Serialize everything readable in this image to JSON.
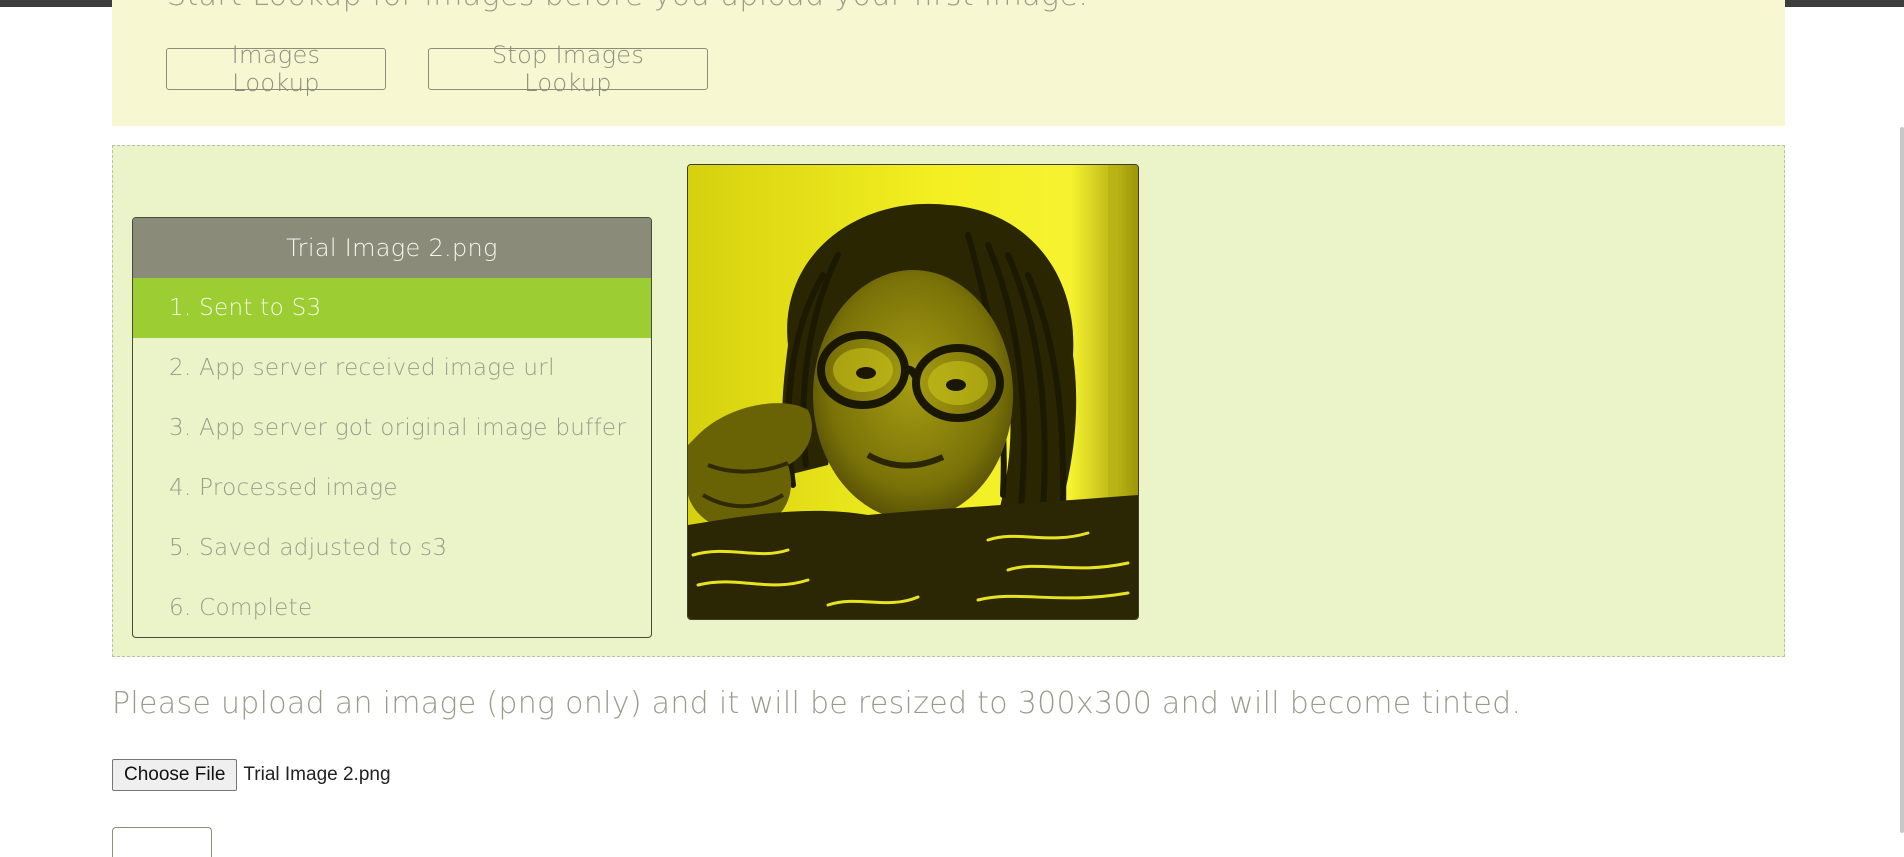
{
  "lookup": {
    "hint": "Start Lookup for images before you upload your first image.",
    "images_lookup_label": "Images Lookup",
    "stop_images_lookup_label": "Stop Images Lookup"
  },
  "status": {
    "file_title": "Trial Image 2.png",
    "active_step": 1,
    "steps": [
      {
        "label": "1. Sent to S3"
      },
      {
        "label": "2. App server received image url"
      },
      {
        "label": "3. App server got original image buffer"
      },
      {
        "label": "4. Processed image"
      },
      {
        "label": "5. Saved adjusted to s3"
      },
      {
        "label": "6. Complete"
      }
    ]
  },
  "upload": {
    "instructions": "Please upload an image (png only) and it will be resized to 300x300 and will become tinted.",
    "choose_file_label": "Choose File",
    "selected_file": "Trial Image 2.png"
  },
  "colors": {
    "accent_green": "#9ccd32",
    "panel_bg": "#ebf3c9",
    "lookup_bg": "#f7f8d2",
    "header_bg": "#8b8b79",
    "tint": "#efeb1c"
  }
}
